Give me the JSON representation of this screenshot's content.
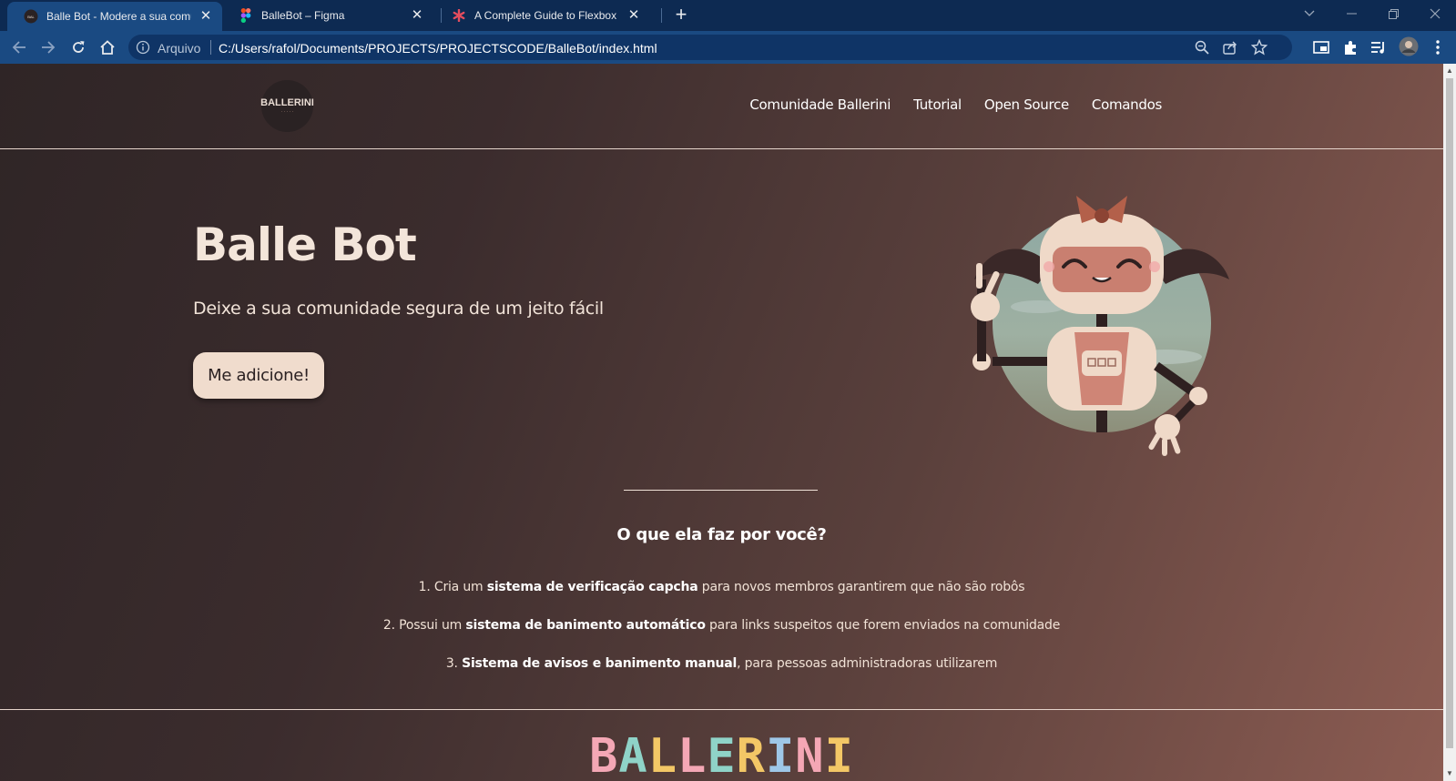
{
  "browser": {
    "tabs": [
      {
        "title": "Balle Bot - Modere a sua comunidade",
        "active": true
      },
      {
        "title": "BalleBot – Figma",
        "active": false
      },
      {
        "title": "A Complete Guide to Flexbox | CSS-Tricks",
        "active": false
      }
    ],
    "omnibox": {
      "security_label": "Arquivo",
      "url": "C:/Users/rafol/Documents/PROJECTS/PROJECTSCODE/BalleBot/index.html"
    }
  },
  "page": {
    "logo": {
      "text": "BALLERINI",
      "subtext": "· · · · ·"
    },
    "nav": [
      "Comunidade Ballerini",
      "Tutorial",
      "Open Source",
      "Comandos"
    ],
    "hero": {
      "title": "Balle Bot",
      "subtitle": "Deixe a sua comunidade segura de um jeito fácil",
      "cta": "Me adicione!"
    },
    "features": {
      "title": "O que ela faz por você?",
      "items": [
        {
          "prefix": "1. Cria um ",
          "bold": "sistema de verificação capcha",
          "suffix": " para novos membros garantirem que não são robôs"
        },
        {
          "prefix": "2. Possui um ",
          "bold": "sistema de banimento automático",
          "suffix": " para links suspeitos que forem enviados na comunidade"
        },
        {
          "prefix": "3. ",
          "bold": "Sistema de avisos e banimento manual",
          "suffix": ", para pessoas administradoras utilizarem"
        }
      ]
    },
    "footer": {
      "letters": [
        "B",
        "A",
        "L",
        "L",
        "E",
        "R",
        "I",
        "N",
        "I"
      ],
      "letter_colors": [
        "#f4a7b5",
        "#8fd3c8",
        "#f3c766",
        "#f4a7b5",
        "#8fd3c8",
        "#f3c766",
        "#9ec7e8",
        "#f4a7b5",
        "#f3c766"
      ]
    }
  },
  "colors": {
    "tabstrip": "#0d2a52",
    "toolbar": "#1a4a82",
    "page_gradient_start": "#2f2526",
    "page_gradient_end": "#8c5c52",
    "cta_background": "#f0dccd",
    "text_light": "#f3e5da"
  }
}
